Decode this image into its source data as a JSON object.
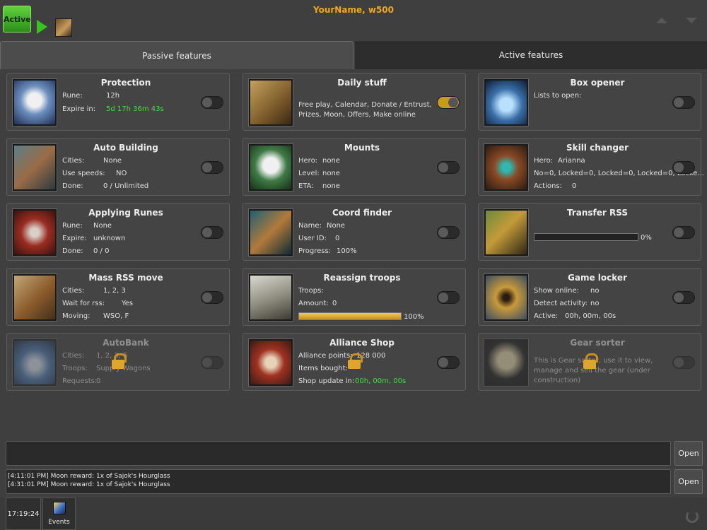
{
  "header": {
    "active_label": "Active",
    "player_name": "YourName, w500"
  },
  "tabs": {
    "passive": "Passive features",
    "active": "Active features"
  },
  "features": {
    "protection": {
      "title": "Protection",
      "rows": [
        {
          "label": "Rune:",
          "value": "12h"
        },
        {
          "label": "Expire in:",
          "value": "5d 17h 36m 43s"
        }
      ],
      "enabled": false
    },
    "daily_stuff": {
      "title": "Daily stuff",
      "text": "Free play, Calendar, Donate / Entrust, Prizes, Moon, Offers, Make online",
      "enabled": true
    },
    "box_opener": {
      "title": "Box opener",
      "rows": [
        {
          "label": "Lists to open:",
          "value": ""
        }
      ],
      "enabled": false
    },
    "auto_building": {
      "title": "Auto Building",
      "rows": [
        {
          "label": "Cities:",
          "value": "None"
        },
        {
          "label": "Use speeds:",
          "value": "NO"
        },
        {
          "label": "Done:",
          "value": "0 / Unlimited"
        }
      ],
      "enabled": false
    },
    "mounts": {
      "title": "Mounts",
      "rows": [
        {
          "label": "Hero:",
          "value": "none"
        },
        {
          "label": "Level:",
          "value": "none"
        },
        {
          "label": "ETA:",
          "value": "none"
        }
      ],
      "enabled": false
    },
    "skill_changer": {
      "title": "Skill changer",
      "rows": [
        {
          "label": "Hero:",
          "value": "Arianna"
        },
        {
          "label": "",
          "value": "No=0, Locked=0, Locked=0, Locked=0, Locke..."
        },
        {
          "label": "Actions:",
          "value": "0"
        }
      ],
      "enabled": false
    },
    "applying_runes": {
      "title": "Applying Runes",
      "rows": [
        {
          "label": "Rune:",
          "value": "None"
        },
        {
          "label": "Expire:",
          "value": "unknown"
        },
        {
          "label": "Done:",
          "value": "0 / 0"
        }
      ],
      "enabled": false
    },
    "coord_finder": {
      "title": "Coord finder",
      "rows": [
        {
          "label": "Name:",
          "value": "None"
        },
        {
          "label": "User ID:",
          "value": "0"
        },
        {
          "label": "Progress:",
          "value": "100%"
        }
      ],
      "enabled": false
    },
    "transfer_rss": {
      "title": "Transfer RSS",
      "progress": 0,
      "progress_label": "0%",
      "enabled": false
    },
    "mass_rss_move": {
      "title": "Mass RSS move",
      "rows": [
        {
          "label": "Cities:",
          "value": "1, 2, 3"
        },
        {
          "label": "Wait for rss:",
          "value": "Yes"
        },
        {
          "label": "Moving:",
          "value": "WSO, F"
        }
      ],
      "enabled": false
    },
    "reassign_troops": {
      "title": "Reassign troops",
      "rows": [
        {
          "label": "Troops:",
          "value": ""
        },
        {
          "label": "Amount:",
          "value": "0"
        }
      ],
      "progress": 100,
      "progress_label": "100%",
      "enabled": false
    },
    "game_locker": {
      "title": "Game locker",
      "rows": [
        {
          "label": "Show online:",
          "value": "no"
        },
        {
          "label": "Detect activity:",
          "value": "no"
        },
        {
          "label": "Active:",
          "value": "00h, 00m, 00s"
        }
      ],
      "enabled": false
    },
    "autobank": {
      "title": "AutoBank",
      "rows": [
        {
          "label": "Cities:",
          "value": "1, 2, 3, 5"
        },
        {
          "label": "Troops:",
          "value": "Supply Wagons"
        },
        {
          "label": "Requests:",
          "value": "0"
        }
      ],
      "enabled": false,
      "locked": true
    },
    "alliance_shop": {
      "title": "Alliance Shop",
      "rows": [
        {
          "label": "Alliance points:",
          "value": "128 000"
        },
        {
          "label": "Items bought:",
          "value": ""
        },
        {
          "label": "Shop update in:",
          "value": "00h, 00m, 00s"
        }
      ],
      "enabled": false
    },
    "gear_sorter": {
      "title": "Gear sorter",
      "text": "This is Gear sorter, use it to view, manage and sell the gear (under construction)",
      "enabled": false,
      "locked": true
    }
  },
  "bottom": {
    "open_label": "Open",
    "log": [
      "[4:11:01 PM]  Moon reward: 1x of Sajok's Hourglass",
      "[4:31:01 PM]  Moon reward: 1x of Sajok's Hourglass"
    ],
    "clock": "17:19:24",
    "events_label": "Events"
  },
  "colors": {
    "accent_orange": "#f0a81e",
    "green_text": "#3fe03a",
    "toggle_on": "#c89a1a",
    "active_green": "#35c51c"
  }
}
